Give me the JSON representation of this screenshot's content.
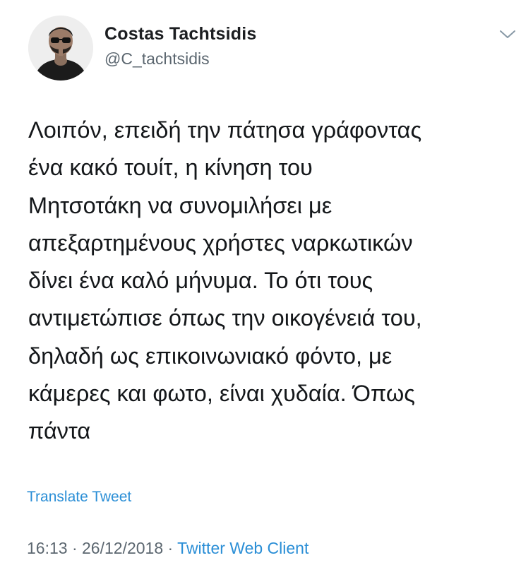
{
  "tweet": {
    "display_name": "Costas Tachtsidis",
    "handle": "@C_tachtsidis",
    "text_lines": [
      "Λοιπόν, επειδή την πάτησα γράφοντας",
      "ένα κακό τουίτ, η κίνηση του",
      "Μητσοτάκη να συνομιλήσει με",
      "απεξαρτημένους χρήστες ναρκωτικών",
      "δίνει ένα καλό μήνυμα. Το ότι τους",
      "αντιμετώπισε όπως την οικογένειά του,",
      "δηλαδή ως επικοινωνιακό φόντο, με",
      "κάμερες και φωτο, είναι χυδαία. Όπως",
      "πάντα"
    ],
    "translate_label": "Translate Tweet",
    "time": "16:13",
    "separator": " · ",
    "date": "26/12/2018",
    "client": "Twitter Web Client"
  },
  "icons": {
    "avatar": "avatar",
    "menu": "chevron-down-icon"
  },
  "colors": {
    "link": "#2a8ed6",
    "secondary_text": "#5c6770",
    "primary_text": "#14171a"
  }
}
